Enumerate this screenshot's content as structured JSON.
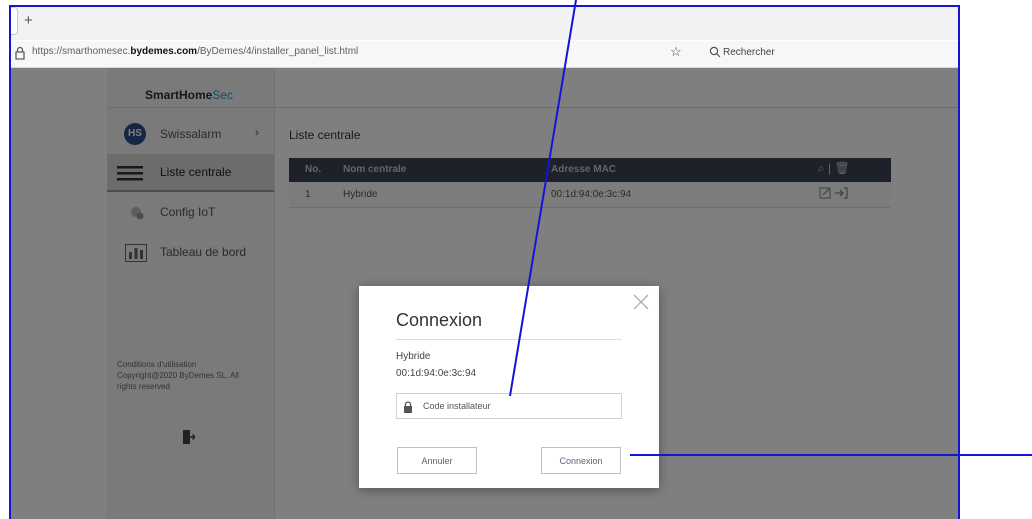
{
  "browser": {
    "new_tab_glyph": "+",
    "url_prefix": "https://smarthomesec.",
    "url_domain": "bydemes.com",
    "url_path": "/ByDemes/4/installer_panel_list.html",
    "bookmark_glyph": "☆",
    "search_placeholder": "Rechercher"
  },
  "app": {
    "brand_primary": "SmartHome",
    "brand_secondary": "Sec"
  },
  "sidebar": {
    "account_initials": "HS",
    "account_name": "Swissalarm",
    "account_chevron": "›",
    "items": [
      {
        "label": "Liste centrale",
        "icon": "list-icon"
      },
      {
        "label": "Config IoT",
        "icon": "iot-icon"
      },
      {
        "label": "Tableau de bord",
        "icon": "dashboard-icon"
      }
    ],
    "footer_line1": "Conditions d'utilisation",
    "footer_line2": "Copyright@2020 ByDemes SL. All rights reserved"
  },
  "main": {
    "title": "Liste centrale",
    "table": {
      "columns": [
        "No.",
        "Nom centrale",
        "Adresse MAC"
      ],
      "tools": "⌕ | 🗑",
      "rows": [
        {
          "no": "1",
          "name": "Hybride",
          "mac": "00:1d:94:0e:3c:94"
        }
      ]
    }
  },
  "modal": {
    "title": "Connexion",
    "panel_name": "Hybride",
    "panel_mac": "00:1d:94:0e:3c:94",
    "code_placeholder": "Code installateur",
    "cancel_label": "Annuler",
    "connect_label": "Connexion"
  },
  "colors": {
    "brand_accent": "#1aa0d8",
    "table_header": "#3b4252",
    "annotation": "#1414d6"
  }
}
